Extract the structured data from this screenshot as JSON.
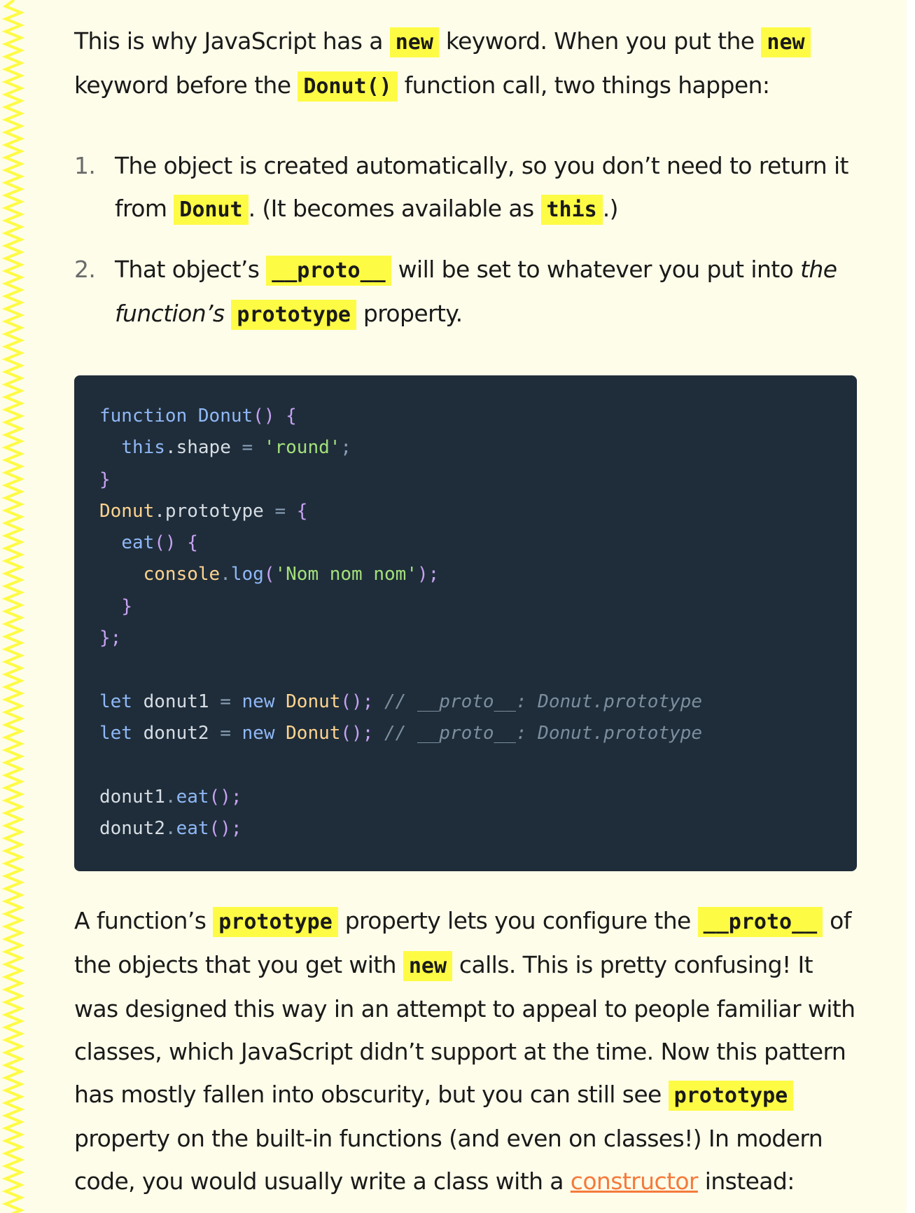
{
  "intro": {
    "t1": "This is why JavaScript has a ",
    "c1": "new",
    "t2": " keyword. When you put the ",
    "c2": "new",
    "t3": " keyword before the ",
    "c3": "Donut()",
    "t4": " function call, two things happen:"
  },
  "steps": [
    {
      "num": "1.",
      "t1": "The object is created automatically, so you don’t need to return it from ",
      "c1": "Donut",
      "t2": ". (It becomes available as ",
      "c2": "this",
      "t3": ".)"
    },
    {
      "num": "2.",
      "t1": "That object’s ",
      "c1": "__proto__",
      "t2": " will be set to whatever you put into ",
      "em": "the function’s",
      "t3": " ",
      "c2": "prototype",
      "t4": " property."
    }
  ],
  "code": {
    "l1_kw": "function",
    "l1_fn": "Donut",
    "l1_rest": "() {",
    "l2_this": "this",
    "l2_prop": ".shape",
    "l2_eq": " = ",
    "l2_str": "'round'",
    "l2_semi": ";",
    "l3": "}",
    "l4_obj": "Donut",
    "l4_prop": ".prototype",
    "l4_eq": " = ",
    "l4_brace": "{",
    "l5_fn": "eat",
    "l5_rest": "() {",
    "l6_obj": "console",
    "l6_dot": ".",
    "l6_fn": "log",
    "l6_open": "(",
    "l6_str": "'Nom nom nom'",
    "l6_close": ");",
    "l7": "}",
    "l8": "};",
    "l9_kw": "let",
    "l9_var": " donut1 ",
    "l9_eq": "= ",
    "l9_new": "new",
    "l9_fn": " Donut",
    "l9_call": "();",
    "l9_cm": " // __proto__: Donut.prototype",
    "l10_kw": "let",
    "l10_var": " donut2 ",
    "l10_eq": "= ",
    "l10_new": "new",
    "l10_fn": " Donut",
    "l10_call": "();",
    "l10_cm": " // __proto__: Donut.prototype",
    "l11_var": "donut1",
    "l11_dot": ".",
    "l11_fn": "eat",
    "l11_call": "();",
    "l12_var": "donut2",
    "l12_dot": ".",
    "l12_fn": "eat",
    "l12_call": "();"
  },
  "outro": {
    "t1": "A function’s ",
    "c1": "prototype",
    "t2": " property lets you configure the ",
    "c2": "__proto__",
    "t3": " of the objects that you get with ",
    "c3": "new",
    "t4": " calls. This is pretty confusing! It was designed this way in an attempt to appeal to people familiar with classes, which JavaScript didn’t support at the time. Now this pattern has mostly fallen into obscurity, but you can still see ",
    "c4": "prototype",
    "t5": " property on the built-in functions (and even on classes!) In modern code, you would usually write a class with a ",
    "link": "constructor",
    "t6": " instead:"
  },
  "colors": {
    "page_bg": "#fefdea",
    "highlight": "#fefb45",
    "code_bg": "#1f2d3a",
    "link": "#f57a3c",
    "zigzag": "#fefb45"
  }
}
